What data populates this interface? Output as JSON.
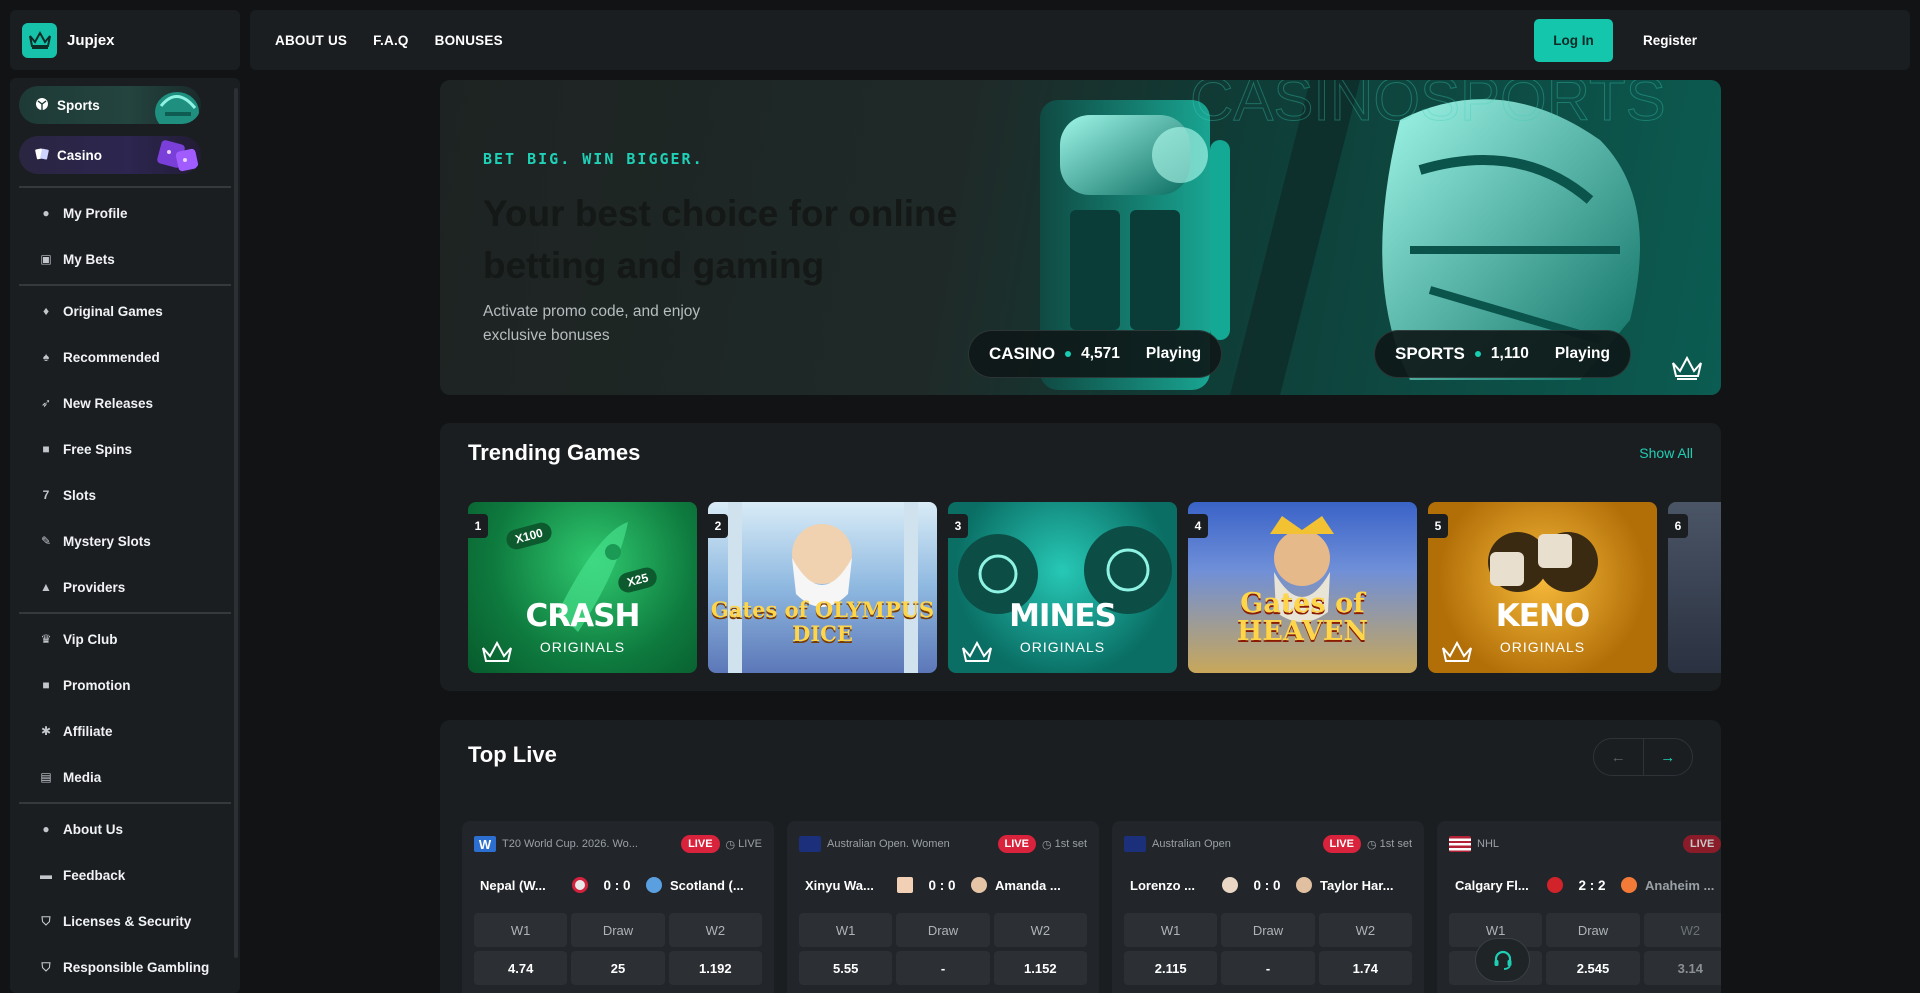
{
  "brand": {
    "name": "Jupjex"
  },
  "sidebar": {
    "top_pills": [
      {
        "label": "Sports",
        "icon": "ball-icon"
      },
      {
        "label": "Casino",
        "icon": "cards-icon"
      }
    ],
    "groups": [
      [
        {
          "label": "My Profile",
          "icon": "person-icon"
        },
        {
          "label": "My Bets",
          "icon": "bets-icon"
        }
      ],
      [
        {
          "label": "Original Games",
          "icon": "flame-icon"
        },
        {
          "label": "Recommended",
          "icon": "cards-icon"
        },
        {
          "label": "New Releases",
          "icon": "rocket-icon"
        },
        {
          "label": "Free Spins",
          "icon": "gift-icon"
        },
        {
          "label": "Slots",
          "icon": "slots-icon"
        },
        {
          "label": "Mystery Slots",
          "icon": "mystery-icon"
        },
        {
          "label": "Providers",
          "icon": "providers-icon"
        }
      ],
      [
        {
          "label": "Vip Club",
          "icon": "trophy-icon"
        },
        {
          "label": "Promotion",
          "icon": "gift-icon"
        },
        {
          "label": "Affiliate",
          "icon": "affiliate-icon"
        },
        {
          "label": "Media",
          "icon": "media-icon"
        }
      ],
      [
        {
          "label": "About Us",
          "icon": "people-icon"
        },
        {
          "label": "Feedback",
          "icon": "chat-icon"
        },
        {
          "label": "Licenses & Security",
          "icon": "shield-icon"
        },
        {
          "label": "Responsible Gambling",
          "icon": "shield-check-icon"
        }
      ]
    ]
  },
  "topbar": {
    "links": [
      "ABOUT US",
      "F.A.Q",
      "BONUSES"
    ],
    "login": "Log In",
    "register": "Register"
  },
  "hero": {
    "tagline": "BET BIG. WIN BIGGER.",
    "title": "Your best choice for online betting and gaming",
    "subtitle": "Activate promo code, and enjoy exclusive bonuses",
    "casino": {
      "label": "CASINO",
      "count": "4,571",
      "status": "Playing"
    },
    "sports": {
      "label": "SPORTS",
      "count": "1,110",
      "status": "Playing"
    }
  },
  "trending": {
    "title": "Trending Games",
    "show_all": "Show All",
    "games": [
      {
        "rank": "1",
        "title": "CRASH",
        "sub": "ORIGINALS"
      },
      {
        "rank": "2",
        "title": "Gates of OLYMPUS DICE",
        "sub": ""
      },
      {
        "rank": "3",
        "title": "MINES",
        "sub": "ORIGINALS"
      },
      {
        "rank": "4",
        "title": "Gates of HEAVEN",
        "sub": ""
      },
      {
        "rank": "5",
        "title": "KENO",
        "sub": "ORIGINALS"
      },
      {
        "rank": "6",
        "title": "",
        "sub": ""
      }
    ],
    "crash_mults": [
      "X100",
      "X25"
    ]
  },
  "toplive": {
    "title": "Top Live",
    "matches": [
      {
        "league": "T20 World Cup. 2026. Wo...",
        "live": "LIVE",
        "time": "LIVE",
        "team1": "Nepal (W...",
        "score": "0 : 0",
        "team2": "Scotland (...",
        "odds_labels": [
          "W1",
          "Draw",
          "W2"
        ],
        "odds": [
          "4.74",
          "25",
          "1.192"
        ]
      },
      {
        "league": "Australian Open. Women",
        "live": "LIVE",
        "time": "1st set",
        "team1": "Xinyu Wa...",
        "score": "0 : 0",
        "team2": "Amanda ...",
        "odds_labels": [
          "W1",
          "Draw",
          "W2"
        ],
        "odds": [
          "5.55",
          "-",
          "1.152"
        ]
      },
      {
        "league": "Australian Open",
        "live": "LIVE",
        "time": "1st set",
        "team1": "Lorenzo ...",
        "score": "0 : 0",
        "team2": "Taylor Har...",
        "odds_labels": [
          "W1",
          "Draw",
          "W2"
        ],
        "odds": [
          "2.115",
          "-",
          "1.74"
        ]
      },
      {
        "league": "NHL",
        "live": "LIVE",
        "time": "",
        "team1": "Calgary Fl...",
        "score": "2 : 2",
        "team2": "Anaheim ...",
        "odds_labels": [
          "W1",
          "Draw",
          "W2"
        ],
        "odds": [
          "",
          "2.545",
          "3.14"
        ]
      }
    ]
  },
  "colors": {
    "accent": "#13c6ac",
    "live": "#d9223b",
    "panel": "#1b1e21",
    "bg": "#111315"
  }
}
